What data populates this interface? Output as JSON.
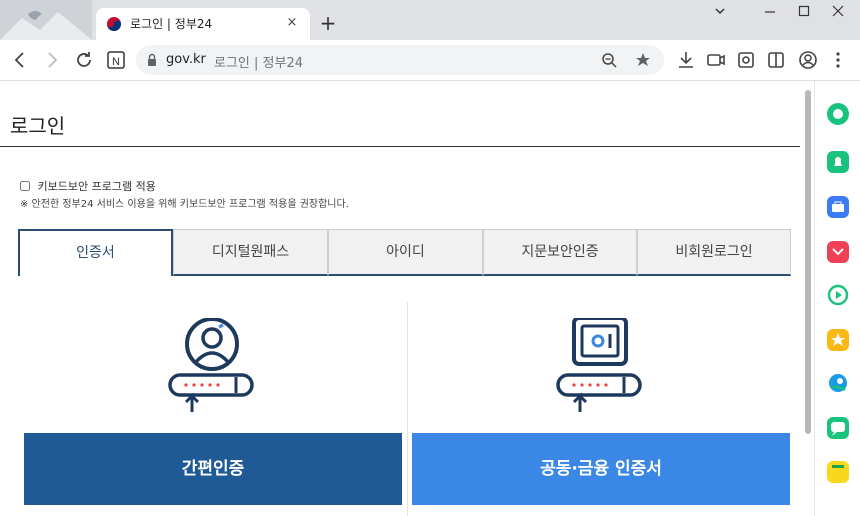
{
  "browser": {
    "tab_title": "로그인 | 정부24",
    "new_tab_label": "+",
    "close_tab_label": "×"
  },
  "address_bar": {
    "host": "gov.kr",
    "rest": "로그인 | 정부24"
  },
  "page": {
    "heading": "로그인",
    "keyboard_security_label": "키보드보안 프로그램 적용",
    "notice": "※ 안전한 정부24 서비스 이용을 위해 키보드보안 프로그램 적용을 권장합니다.",
    "tabs": [
      "인증서",
      "디지털원패스",
      "아이디",
      "지문보안인증",
      "비회원로그인"
    ],
    "active_tab": "인증서",
    "buttons": {
      "simple_auth": "간편인증",
      "joint_financial_cert": "공동·금융 인증서"
    }
  },
  "colors": {
    "simple_auth_bg": "#1f5a96",
    "joint_cert_bg": "#3b87e6",
    "accent": "#2b4c75"
  },
  "side_panel_icons": [
    "circle-icon",
    "bell-icon",
    "briefcase-icon",
    "pocket-icon",
    "play-icon",
    "star-icon",
    "bird-icon",
    "chat-icon",
    "note-icon"
  ]
}
